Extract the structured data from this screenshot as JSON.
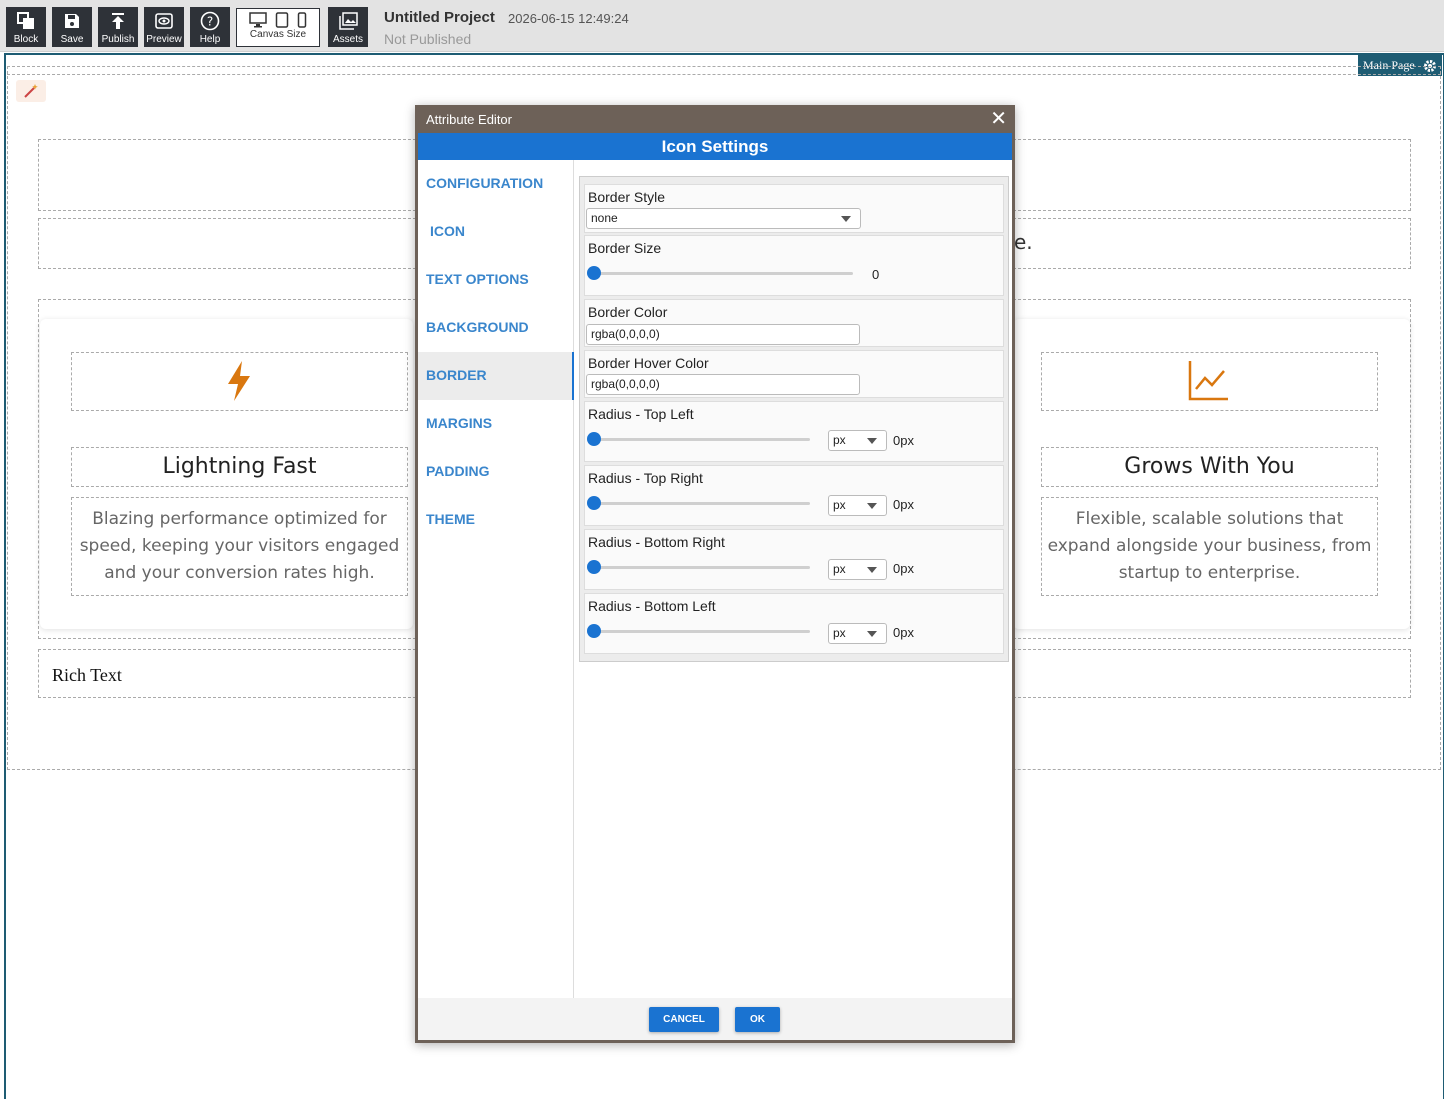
{
  "toolbar": {
    "block_label": "Block",
    "save_label": "Save",
    "publish_label": "Publish",
    "preview_label": "Preview",
    "help_label": "Help",
    "canvas_size_label": "Canvas Size",
    "assets_label": "Assets"
  },
  "project": {
    "title": "Untitled Project",
    "date": "2026-06-15 12:49:24",
    "status": "Not Published"
  },
  "canvas": {
    "main_page_label": "Main Page",
    "partial_text": "e.",
    "card_left": {
      "title": "Lightning Fast",
      "description": "Blazing performance optimized for speed, keeping your visitors engaged and your conversion rates high.",
      "icon_color": "#d9770f"
    },
    "card_right": {
      "title": "Grows With You",
      "description": "Flexible, scalable solutions that expand alongside your business, from startup to enterprise.",
      "icon_color": "#d9770f"
    },
    "rich_text": "Rich Text"
  },
  "modal": {
    "header": "Attribute Editor",
    "subtitle": "Icon Settings",
    "nav": [
      "CONFIGURATION",
      "ICON",
      "TEXT OPTIONS",
      "BACKGROUND COLOR",
      "BORDER",
      "MARGINS",
      "PADDING",
      "THEME"
    ],
    "active_nav": "BORDER",
    "fields": {
      "border_style_label": "Border Style",
      "border_style_value": "none",
      "border_size_label": "Border Size",
      "border_size_value": "0",
      "border_color_label": "Border Color",
      "border_color_value": "rgba(0,0,0,0)",
      "border_hover_color_label": "Border Hover Color",
      "border_hover_color_value": "rgba(0,0,0,0)",
      "radius_top_left_label": "Radius - Top Left",
      "radius_top_right_label": "Radius - Top Right",
      "radius_bottom_right_label": "Radius - Bottom Right",
      "radius_bottom_left_label": "Radius - Bottom Left",
      "unit": "px",
      "radius_value": "0px"
    },
    "cancel_label": "CANCEL",
    "ok_label": "OK"
  },
  "colors": {
    "accent": "#1a73d1",
    "toolbar_button": "#2e3238",
    "modal_header": "#6d6158",
    "canvas_border": "#1e5c73"
  }
}
